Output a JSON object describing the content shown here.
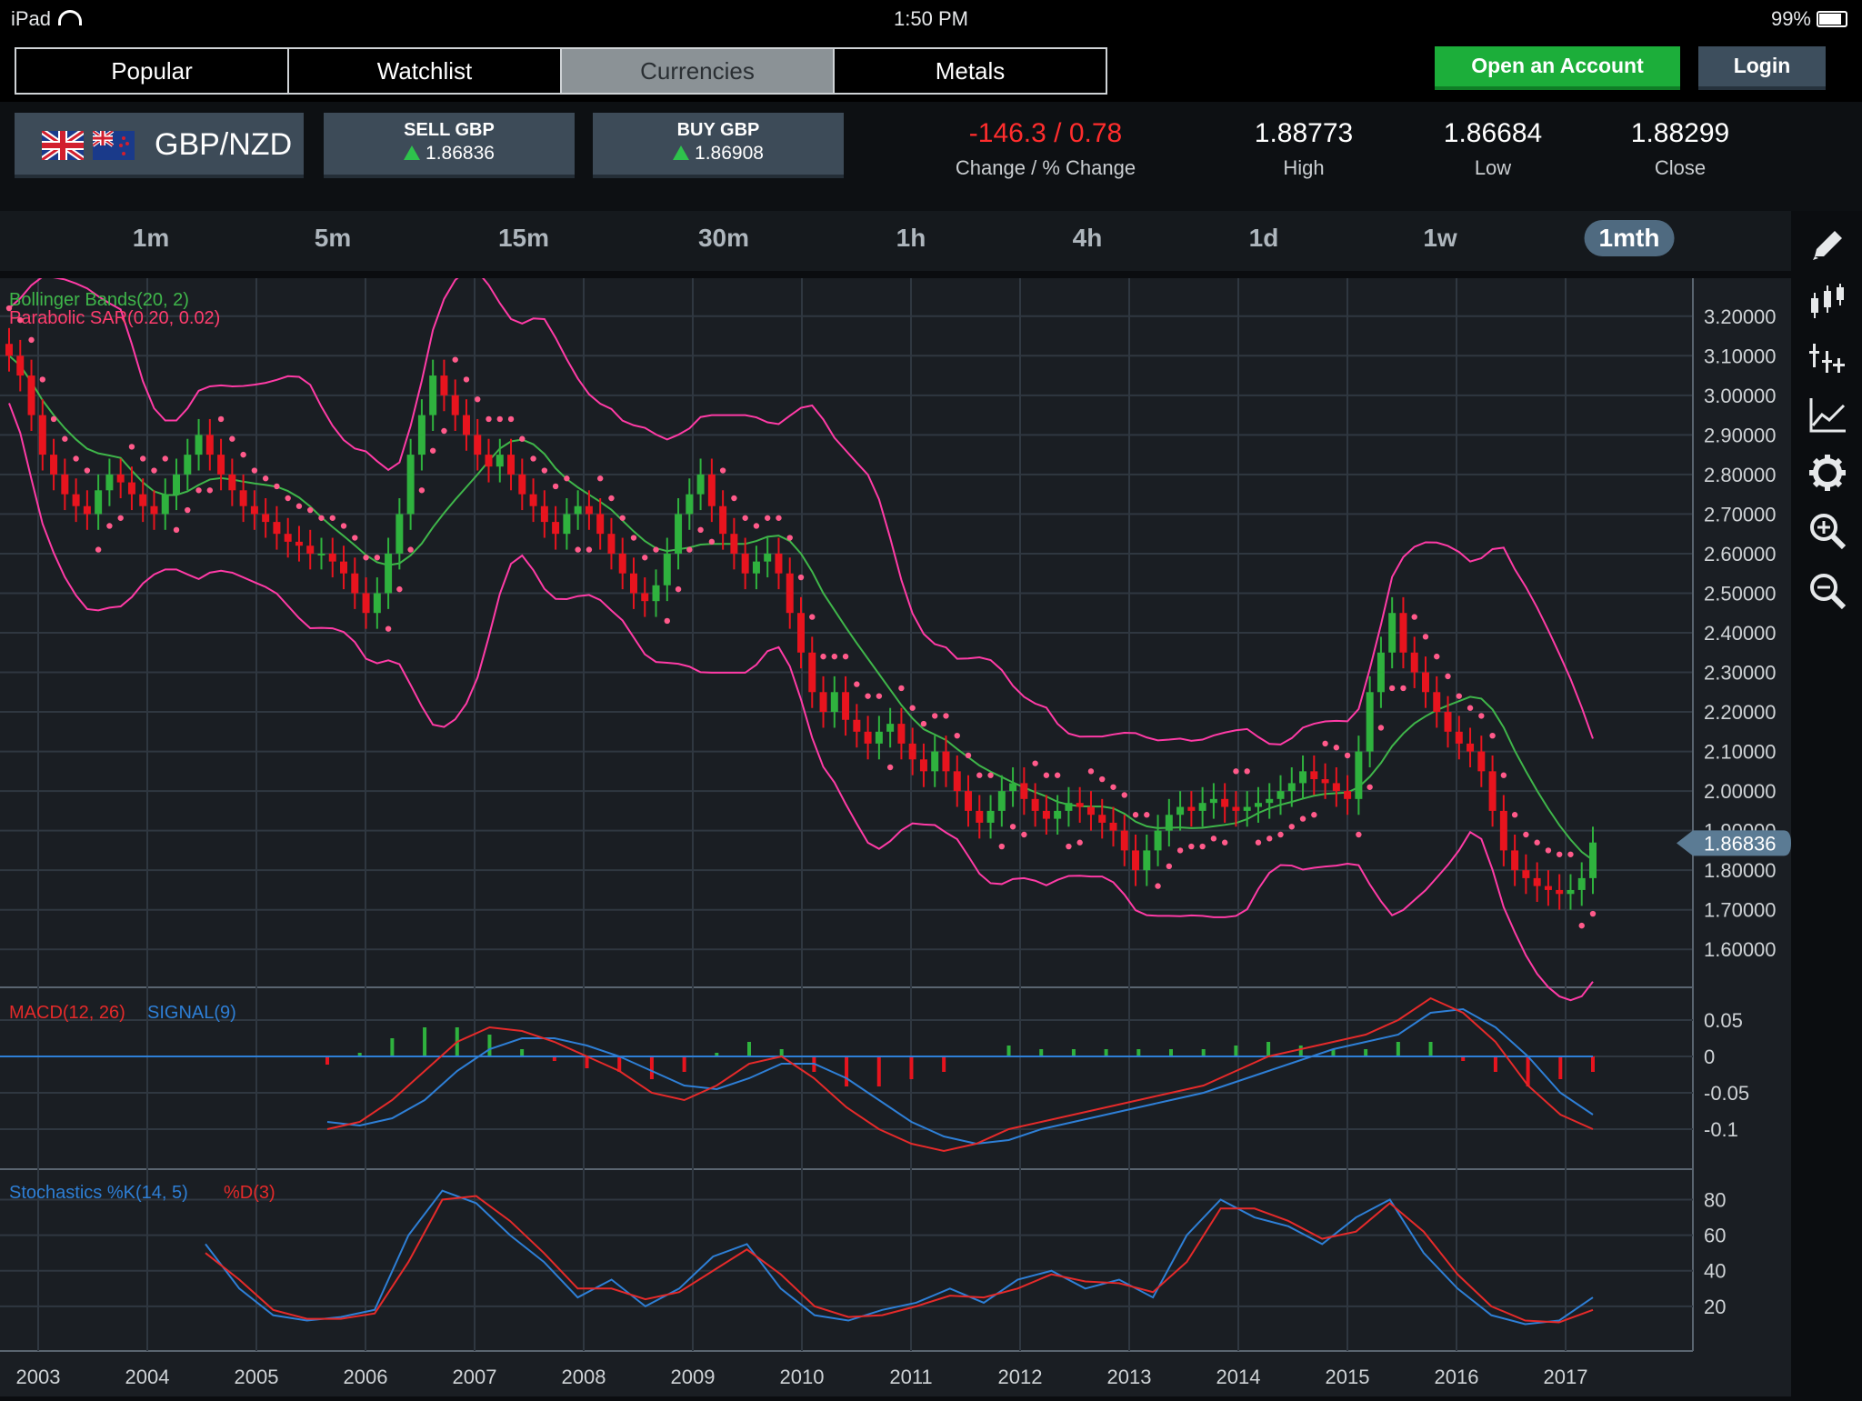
{
  "status": {
    "device": "iPad",
    "time": "1:50 PM",
    "battery": "99%"
  },
  "nav": {
    "tabs": [
      "Popular",
      "Watchlist",
      "Currencies",
      "Metals"
    ],
    "active": "Currencies",
    "open_account": "Open an Account",
    "login": "Login"
  },
  "instrument": {
    "pair": "GBP/NZD",
    "sell": {
      "title": "SELL GBP",
      "price": "1.86836"
    },
    "buy": {
      "title": "BUY GBP",
      "price": "1.86908"
    },
    "change": {
      "value": "-146.3 / 0.78",
      "label": "Change / % Change"
    },
    "high": {
      "value": "1.88773",
      "label": "High"
    },
    "low": {
      "value": "1.86684",
      "label": "Low"
    },
    "close": {
      "value": "1.88299",
      "label": "Close"
    }
  },
  "timeframes": [
    "1m",
    "5m",
    "15m",
    "30m",
    "1h",
    "4h",
    "1d",
    "1w",
    "1mth"
  ],
  "active_timeframe": "1mth",
  "toolbar_icons": [
    "pencil-icon",
    "candlestick-icon",
    "indicator-add-icon",
    "line-chart-icon",
    "gear-icon",
    "zoom-in-icon",
    "zoom-out-icon"
  ],
  "chart_data": {
    "type": "candlestick",
    "indicators": {
      "bollinger": "Bollinger Bands(20, 2)",
      "sar": "Parabolic SAR(0.20, 0.02)",
      "macd": "MACD(12, 26)",
      "signal": "SIGNAL(9)",
      "stoch": "Stochastics %K(14, 5)",
      "stoch_d": "%D(3)"
    },
    "price_ticks": [
      "3.20000",
      "3.10000",
      "3.00000",
      "2.90000",
      "2.80000",
      "2.70000",
      "2.60000",
      "2.50000",
      "2.40000",
      "2.30000",
      "2.20000",
      "2.10000",
      "2.00000",
      "1.90000",
      "1.80000",
      "1.70000",
      "1.60000"
    ],
    "price_ylim": [
      1.55,
      3.25
    ],
    "current_price": "1.86836",
    "macd_ticks": [
      "0.05",
      "0",
      "-0.05",
      "-0.1"
    ],
    "stoch_ticks": [
      "80",
      "60",
      "40",
      "20"
    ],
    "years": [
      "2003",
      "2004",
      "2005",
      "2006",
      "2007",
      "2008",
      "2009",
      "2010",
      "2011",
      "2012",
      "2013",
      "2014",
      "2015",
      "2016",
      "2017"
    ],
    "close_series": [
      3.1,
      3.05,
      2.95,
      2.85,
      2.8,
      2.75,
      2.72,
      2.7,
      2.76,
      2.8,
      2.78,
      2.75,
      2.72,
      2.7,
      2.75,
      2.8,
      2.85,
      2.9,
      2.85,
      2.8,
      2.76,
      2.72,
      2.7,
      2.68,
      2.65,
      2.63,
      2.62,
      2.6,
      2.6,
      2.58,
      2.55,
      2.5,
      2.45,
      2.5,
      2.6,
      2.7,
      2.85,
      2.95,
      3.05,
      3.0,
      2.95,
      2.9,
      2.85,
      2.82,
      2.85,
      2.8,
      2.75,
      2.72,
      2.68,
      2.65,
      2.7,
      2.72,
      2.7,
      2.65,
      2.6,
      2.55,
      2.5,
      2.48,
      2.52,
      2.6,
      2.7,
      2.75,
      2.8,
      2.72,
      2.65,
      2.6,
      2.55,
      2.58,
      2.6,
      2.55,
      2.45,
      2.35,
      2.25,
      2.2,
      2.25,
      2.18,
      2.15,
      2.12,
      2.15,
      2.17,
      2.12,
      2.08,
      2.05,
      2.1,
      2.05,
      2.0,
      1.95,
      1.92,
      1.95,
      2.0,
      2.02,
      1.98,
      1.95,
      1.93,
      1.95,
      1.97,
      1.96,
      1.94,
      1.92,
      1.9,
      1.85,
      1.8,
      1.85,
      1.9,
      1.94,
      1.96,
      1.95,
      1.97,
      1.98,
      1.96,
      1.95,
      1.96,
      1.97,
      1.98,
      2.0,
      2.02,
      2.05,
      2.03,
      2.02,
      2.0,
      1.98,
      2.1,
      2.25,
      2.35,
      2.45,
      2.35,
      2.3,
      2.25,
      2.2,
      2.15,
      2.12,
      2.1,
      2.05,
      1.95,
      1.85,
      1.8,
      1.78,
      1.76,
      1.75,
      1.74,
      1.75,
      1.78,
      1.87
    ],
    "macd_series": [
      -0.1,
      -0.09,
      -0.06,
      -0.02,
      0.02,
      0.04,
      0.035,
      0.02,
      0.0,
      -0.02,
      -0.05,
      -0.06,
      -0.04,
      -0.01,
      0.0,
      -0.03,
      -0.07,
      -0.1,
      -0.12,
      -0.13,
      -0.12,
      -0.1,
      -0.09,
      -0.08,
      -0.07,
      -0.06,
      -0.05,
      -0.04,
      -0.02,
      0.0,
      0.01,
      0.02,
      0.03,
      0.05,
      0.08,
      0.06,
      0.02,
      -0.04,
      -0.08,
      -0.1
    ],
    "signal_series": [
      -0.09,
      -0.095,
      -0.085,
      -0.06,
      -0.02,
      0.01,
      0.025,
      0.025,
      0.015,
      0.0,
      -0.02,
      -0.04,
      -0.045,
      -0.03,
      -0.01,
      -0.01,
      -0.03,
      -0.06,
      -0.09,
      -0.11,
      -0.12,
      -0.115,
      -0.1,
      -0.09,
      -0.08,
      -0.07,
      -0.06,
      -0.05,
      -0.035,
      -0.02,
      -0.005,
      0.01,
      0.02,
      0.03,
      0.06,
      0.065,
      0.04,
      0.0,
      -0.05,
      -0.08
    ],
    "stoch_k": [
      55,
      30,
      15,
      12,
      14,
      18,
      60,
      85,
      78,
      60,
      45,
      25,
      35,
      20,
      30,
      48,
      55,
      30,
      15,
      12,
      18,
      22,
      30,
      22,
      35,
      40,
      30,
      35,
      25,
      60,
      80,
      70,
      65,
      55,
      70,
      80,
      50,
      30,
      15,
      10,
      12,
      25
    ],
    "stoch_d": [
      50,
      35,
      18,
      13,
      13,
      16,
      45,
      80,
      82,
      68,
      50,
      30,
      30,
      24,
      28,
      40,
      52,
      38,
      20,
      14,
      15,
      20,
      26,
      25,
      30,
      38,
      34,
      33,
      28,
      45,
      75,
      75,
      68,
      58,
      62,
      78,
      62,
      38,
      20,
      12,
      11,
      18
    ]
  }
}
